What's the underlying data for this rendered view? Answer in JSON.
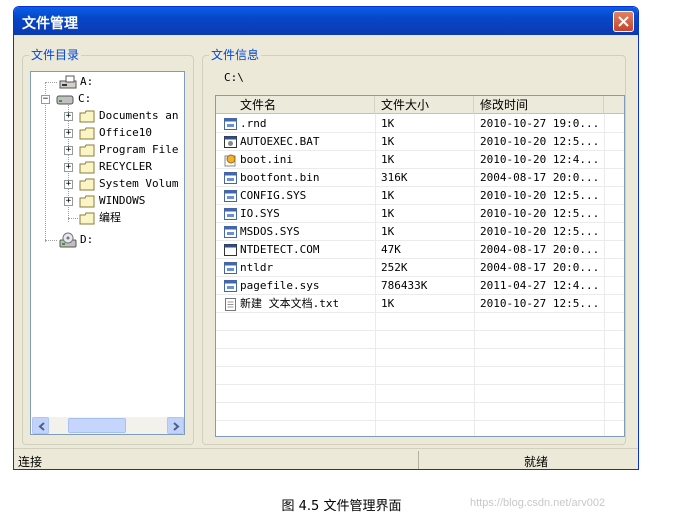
{
  "window": {
    "title": "文件管理"
  },
  "dir_panel": {
    "label": "文件目录",
    "tree": [
      {
        "label": "A:",
        "icon": "floppy-drive-icon",
        "expander": ""
      },
      {
        "label": "C:",
        "icon": "hard-drive-icon",
        "expander": "−"
      },
      {
        "label": "Documents an",
        "icon": "folder-icon",
        "expander": "+"
      },
      {
        "label": "Office10",
        "icon": "folder-icon",
        "expander": "+"
      },
      {
        "label": "Program File",
        "icon": "folder-icon",
        "expander": "+"
      },
      {
        "label": "RECYCLER",
        "icon": "folder-icon",
        "expander": "+"
      },
      {
        "label": "System Volum",
        "icon": "folder-icon",
        "expander": "+"
      },
      {
        "label": "WINDOWS",
        "icon": "folder-icon",
        "expander": "+"
      },
      {
        "label": "编程",
        "icon": "folder-icon",
        "expander": ""
      },
      {
        "label": "D:",
        "icon": "cd-drive-icon",
        "expander": ""
      }
    ]
  },
  "info_panel": {
    "label": "文件信息",
    "path": "C:\\",
    "columns": [
      "文件名",
      "文件大小",
      "修改时间"
    ],
    "rows": [
      {
        "name": ".rnd",
        "size": "1K",
        "time": "2010-10-27 19:0...",
        "icon": "system-file-icon"
      },
      {
        "name": "AUTOEXEC.BAT",
        "size": "1K",
        "time": "2010-10-20 12:5...",
        "icon": "batch-file-icon"
      },
      {
        "name": "boot.ini",
        "size": "1K",
        "time": "2010-10-20 12:4...",
        "icon": "config-file-icon"
      },
      {
        "name": "bootfont.bin",
        "size": "316K",
        "time": "2004-08-17 20:0...",
        "icon": "system-file-icon"
      },
      {
        "name": "CONFIG.SYS",
        "size": "1K",
        "time": "2010-10-20 12:5...",
        "icon": "system-file-icon"
      },
      {
        "name": "IO.SYS",
        "size": "1K",
        "time": "2010-10-20 12:5...",
        "icon": "system-file-icon"
      },
      {
        "name": "MSDOS.SYS",
        "size": "1K",
        "time": "2010-10-20 12:5...",
        "icon": "system-file-icon"
      },
      {
        "name": "NTDETECT.COM",
        "size": "47K",
        "time": "2004-08-17 20:0...",
        "icon": "com-file-icon"
      },
      {
        "name": "ntldr",
        "size": "252K",
        "time": "2004-08-17 20:0...",
        "icon": "system-file-icon"
      },
      {
        "name": "pagefile.sys",
        "size": "786433K",
        "time": "2011-04-27 12:4...",
        "icon": "system-file-icon"
      },
      {
        "name": "新建 文本文档.txt",
        "size": "1K",
        "time": "2010-10-27 12:5...",
        "icon": "text-file-icon"
      }
    ]
  },
  "status": {
    "left": "连接",
    "right": "就绪"
  },
  "caption": "图 4.5  文件管理界面",
  "watermark": "https://blog.csdn.net/arv002",
  "colors": {
    "title_bar": "#0a5ee6",
    "group_label": "#0046d5",
    "close_button": "#c3442a"
  }
}
